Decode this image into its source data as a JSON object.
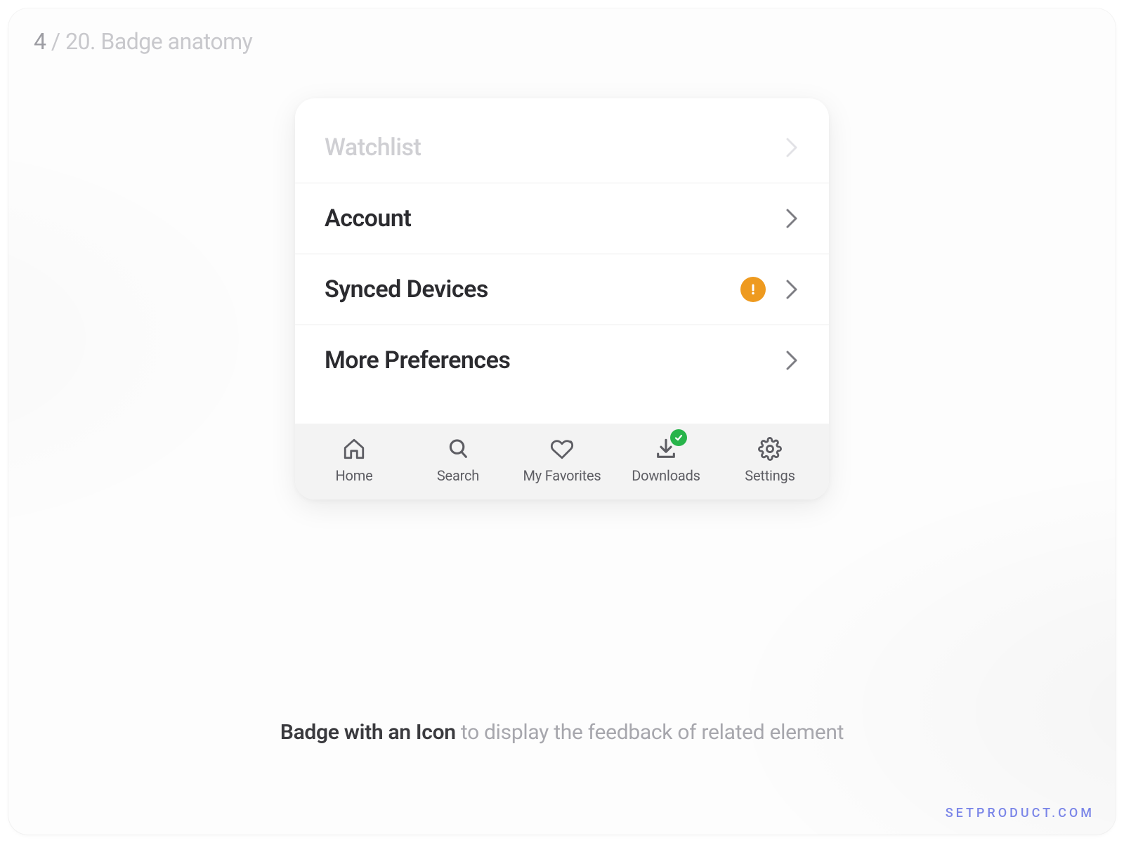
{
  "breadcrumb": {
    "current": "4",
    "sep": " / ",
    "total": "20. Badge anatomy"
  },
  "list": {
    "items": [
      {
        "label": "Watchlist",
        "muted": true,
        "badge": null
      },
      {
        "label": "Account",
        "muted": false,
        "badge": null
      },
      {
        "label": "Synced Devices",
        "muted": false,
        "badge": "alert"
      },
      {
        "label": "More Preferences",
        "muted": false,
        "badge": null
      }
    ]
  },
  "tabs": [
    {
      "label": "Home",
      "icon": "home-icon",
      "badge": null
    },
    {
      "label": "Search",
      "icon": "search-icon",
      "badge": null
    },
    {
      "label": "My Favorites",
      "icon": "heart-icon",
      "badge": null
    },
    {
      "label": "Downloads",
      "icon": "download-icon",
      "badge": "check"
    },
    {
      "label": "Settings",
      "icon": "gear-icon",
      "badge": null
    }
  ],
  "caption": {
    "strong": "Badge with an Icon",
    "rest": " to display the feedback of related element"
  },
  "watermark": "SETPRODUCT.COM",
  "colors": {
    "badgeAlert": "#ee9a1f",
    "badgeCheck": "#27b44a"
  }
}
